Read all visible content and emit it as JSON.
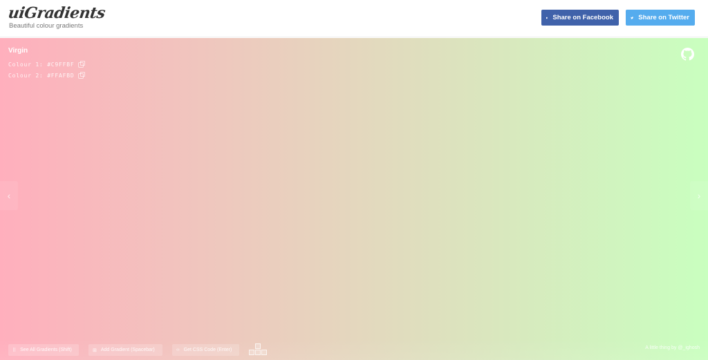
{
  "header": {
    "logo_title": "uiGradients",
    "logo_subtitle": "Beautiful colour gradients",
    "share_facebook": "Share on Facebook",
    "share_twitter": "Share on Twitter",
    "facebook_color": "#4062aa",
    "twitter_color": "#55acee"
  },
  "gradient": {
    "name": "Virgin",
    "colour1_label": "Colour 1:",
    "colour1_value": "#C9FFBF",
    "colour2_label": "Colour 2:",
    "colour2_value": "#FFAFBD",
    "direction": "to right",
    "start_color": "#FFAFBD",
    "end_color": "#C9FFBF"
  },
  "icons": {
    "github": "github-icon",
    "prev": "chevron-left-icon",
    "next": "chevron-right-icon",
    "copy": "copy-icon",
    "arrow_keys": "arrow-keys-icon"
  },
  "nav": {
    "prev_glyph": "‹",
    "next_glyph": "›"
  },
  "footer": {
    "see_all": "See All Gradients (Shift)",
    "add_gradient": "Add Gradient (Spacebar)",
    "get_css": "Get CSS Code (Enter)",
    "see_all_glyph": "⠿",
    "add_glyph": "⊞",
    "css_glyph": "‹›",
    "credit": "A little thing by @_ighosh"
  }
}
